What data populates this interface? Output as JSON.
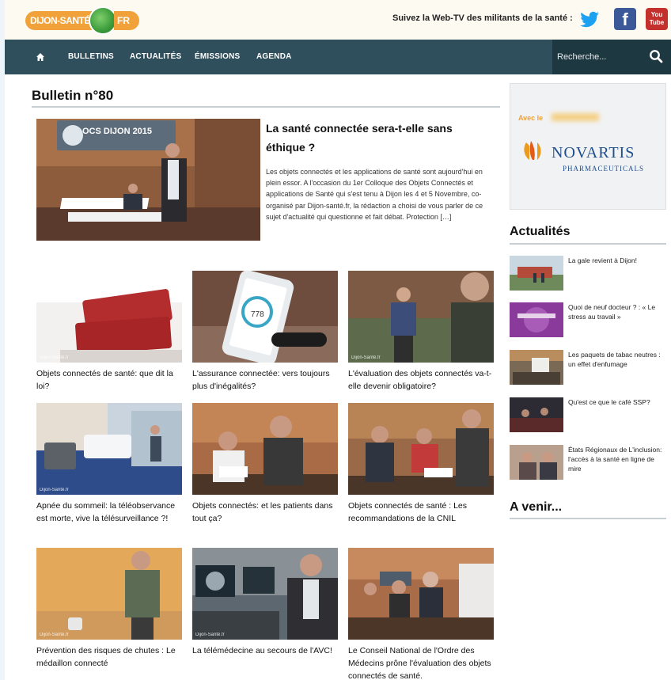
{
  "header": {
    "logo_left": "DIJON-SANTÉ",
    "logo_right": "FR",
    "webtv_text": "Suivez la Web-TV des militants de la santé :",
    "social": {
      "twitter": "twitter-icon",
      "facebook": "f",
      "youtube_line1": "You",
      "youtube_line2": "Tube"
    }
  },
  "nav": {
    "home_icon": "home-icon",
    "items": [
      "BULLETINS",
      "ACTUALITÉS",
      "ÉMISSIONS",
      "AGENDA"
    ],
    "search_placeholder": "Recherche..."
  },
  "main": {
    "title": "Bulletin n°80",
    "featured": {
      "title": "La santé connectée sera-t-elle sans éthique ?",
      "text": "Les objets connectés et les applications de santé sont aujourd'hui en plein essor. A l'occasion du 1er Colloque des Objets Connectés et applications de Santé qui s'est tenu à Dijon les 4 et 5 Novembre, co-organisé par Dijon-santé.fr, la rédaction a choisi de vous parler de ce sujet d'actualité qui questionne et fait débat. Protection […]",
      "banner": "OCS DIJON 2015"
    },
    "watermark": "Dijon-Santé.fr",
    "cards": [
      {
        "title": "Objets connectés de santé: que dit la loi?"
      },
      {
        "title": "L'assurance connectée: vers toujours plus d'inégalités?"
      },
      {
        "title": "L'évaluation des objets connectés va-t-elle devenir obligatoire?"
      },
      {
        "title": "Apnée du sommeil: la téléobservance est morte, vive la télésurveillance ?!"
      },
      {
        "title": "Objets connectés: et les patients dans tout ça?"
      },
      {
        "title": "Objets connectés de santé : Les recommandations de la CNIL"
      },
      {
        "title": "Prévention des risques de chutes : Le médaillon connecté"
      },
      {
        "title": "La télémédecine au secours de l'AVC!"
      },
      {
        "title": "Le Conseil National de l'Ordre des Médecins prône l'évaluation des objets connectés de santé."
      }
    ],
    "phone_value": "778"
  },
  "sidebar": {
    "ad": {
      "avec": "Avec le",
      "brand": "NOVARTIS",
      "sub": "PHARMACEUTICALS"
    },
    "actualites_title": "Actualités",
    "news": [
      {
        "text": "La gale revient à Dijon!"
      },
      {
        "text": "Quoi de neuf docteur ? : « Le stress au travail »"
      },
      {
        "text": "Les paquets de tabac neutres : un effet d'enfumage"
      },
      {
        "text": "Qu'est ce que le café SSP?"
      },
      {
        "text": "États Régionaux de L'inclusion: l'accès à la santé en ligne de mire"
      }
    ],
    "avenir_title": "A venir..."
  }
}
